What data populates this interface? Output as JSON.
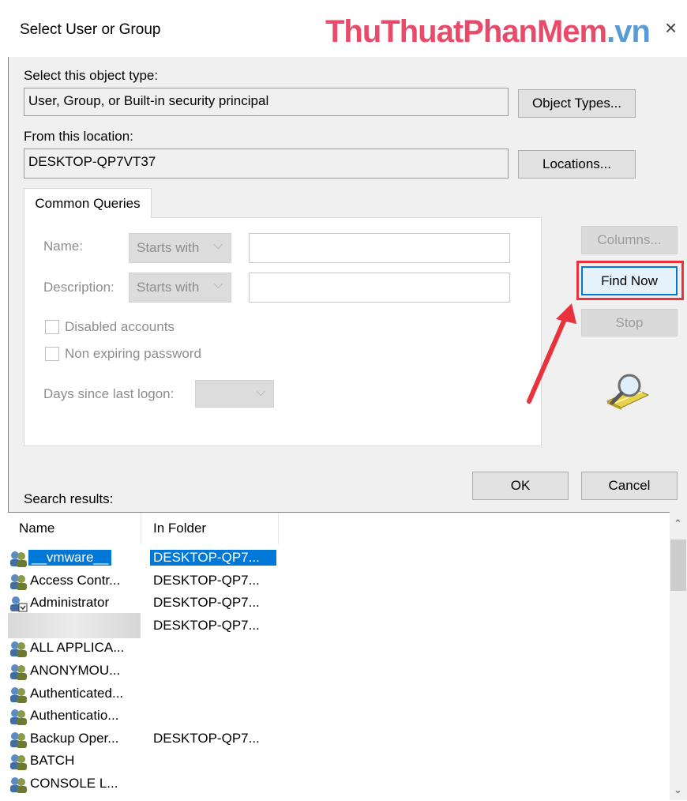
{
  "window": {
    "title": "Select User or Group",
    "watermark_main": "ThuThuatPhanMem",
    "watermark_tail": ".vn",
    "close_icon": "×"
  },
  "object_type": {
    "label": "Select this object type:",
    "value": "User, Group, or Built-in security principal",
    "button": "Object Types..."
  },
  "location": {
    "label": "From this location:",
    "value": "DESKTOP-QP7VT37",
    "button": "Locations..."
  },
  "queries": {
    "tab": "Common Queries",
    "name_label": "Name:",
    "name_mode": "Starts with",
    "desc_label": "Description:",
    "desc_mode": "Starts with",
    "disabled_accounts": "Disabled accounts",
    "non_expiring": "Non expiring password",
    "days_label": "Days since last logon:",
    "days_value": ""
  },
  "actions": {
    "columns": "Columns...",
    "find_now": "Find Now",
    "stop": "Stop",
    "ok": "OK",
    "cancel": "Cancel"
  },
  "results": {
    "label": "Search results:",
    "col_name": "Name",
    "col_folder": "In Folder",
    "rows": [
      {
        "name": "__vmware__",
        "folder": "DESKTOP-QP7...",
        "icon": "group-icon",
        "selected": true
      },
      {
        "name": "Access Contr...",
        "folder": "DESKTOP-QP7...",
        "icon": "group-icon"
      },
      {
        "name": "Administrator",
        "folder": "DESKTOP-QP7...",
        "icon": "user-icon"
      },
      {
        "name": "",
        "folder": "DESKTOP-QP7...",
        "icon": "blurred"
      },
      {
        "name": "ALL APPLICA...",
        "folder": "",
        "icon": "group-icon"
      },
      {
        "name": "ANONYMOU...",
        "folder": "",
        "icon": "group-icon"
      },
      {
        "name": "Authenticated...",
        "folder": "",
        "icon": "group-icon"
      },
      {
        "name": "Authenticatio...",
        "folder": "",
        "icon": "group-icon"
      },
      {
        "name": "Backup Oper...",
        "folder": "DESKTOP-QP7...",
        "icon": "group-icon"
      },
      {
        "name": "BATCH",
        "folder": "",
        "icon": "group-icon"
      },
      {
        "name": "CONSOLE L...",
        "folder": "",
        "icon": "group-icon"
      }
    ]
  },
  "colors": {
    "accent": "#0078d7",
    "highlight": "#e8323c",
    "arrow": "#e8323c"
  }
}
